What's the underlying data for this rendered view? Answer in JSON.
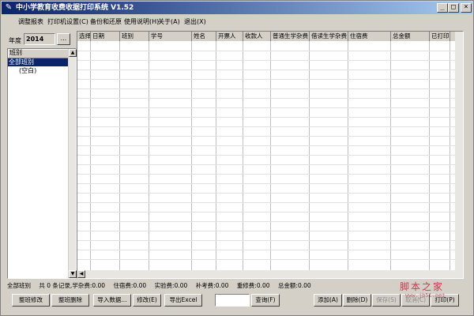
{
  "window": {
    "title": "中小学教育收费收据打印系统 V1.52",
    "controls": {
      "minimize": "_",
      "maximize": "□",
      "close": "×"
    }
  },
  "menu": [
    "调整报表",
    "打印机设置(C)",
    "备份和还原",
    "使用说明(H)",
    "关于(A)",
    "退出(X)"
  ],
  "year": {
    "label": "年度",
    "value": "2014",
    "browse": "..."
  },
  "class_list": {
    "header": "班别",
    "items": [
      "全部班别",
      "(空白)"
    ],
    "selected_index": 0
  },
  "grid": {
    "columns": [
      "选择",
      "日期",
      "班别",
      "学号",
      "姓名",
      "开票人",
      "收款人",
      "普通生学杂费",
      "借读生学杂费",
      "住宿费",
      "总金额",
      "已打印"
    ]
  },
  "status": {
    "class": "全部班别",
    "records": "共 0 条记录,学杂费:0.00",
    "lodging": "住宿费:0.00",
    "lab": "实验费:0.00",
    "tuition": "补考费:0.00",
    "repair": "重修费:0.00",
    "total": "总金额:0.00"
  },
  "buttons": {
    "modify_class": "整班修改",
    "delete_class": "整班删除",
    "import": "导入数据...",
    "edit": "修改(E)",
    "export": "导出Excel",
    "query": "查询(F)",
    "add": "添加(A)",
    "delete": "删除(D)",
    "save": "保存(S)",
    "cancel": "取消(C)",
    "print": "打印(P)"
  },
  "watermark": {
    "main": "脚本之家",
    "sub": "www.jb51.net"
  }
}
